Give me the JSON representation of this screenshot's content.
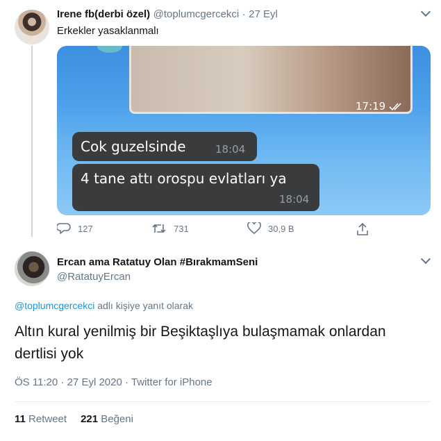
{
  "quoted_tweet": {
    "name": "Irene fb(derbi özel)",
    "handle": "@toplumcgercekci",
    "separator": "·",
    "date": "27 Eyl",
    "text": "Erkekler yasaklanmalı",
    "media": {
      "photo_time": "17:19",
      "messages": [
        {
          "text": "Cok guzelsinde",
          "time": "18:04"
        },
        {
          "text": "4 tane attı orospu evlatları ya",
          "time": "18:04"
        }
      ]
    },
    "actions": {
      "reply_count": "127",
      "retweet_count": "731",
      "like_count": "30,9 B"
    }
  },
  "main_tweet": {
    "name": "Ercan ama Ratatuy Olan #BırakmamSeni",
    "handle": "@RatatuyErcan",
    "replying_to": "@toplumcgercekci",
    "replying_suffix": "adlı kişiye yanıt olarak",
    "text": "Altın kural yenilmiş bir Beşiktaşlıya bulaşmamak onlardan dertlisi yok",
    "meta": "ÖS 11:20 · 27 Eyl 2020 · Twitter for iPhone",
    "retweet_count": "11",
    "retweet_label": "Retweet",
    "like_count": "221",
    "like_label": "Beğeni"
  },
  "icons": {
    "reply": "reply-icon",
    "retweet": "retweet-icon",
    "like": "heart-icon",
    "share": "share-icon",
    "chevron": "chevron-down-icon"
  },
  "colors": {
    "link": "#1b95e0",
    "secondary_text": "#657786",
    "primary_text": "#14171a"
  }
}
